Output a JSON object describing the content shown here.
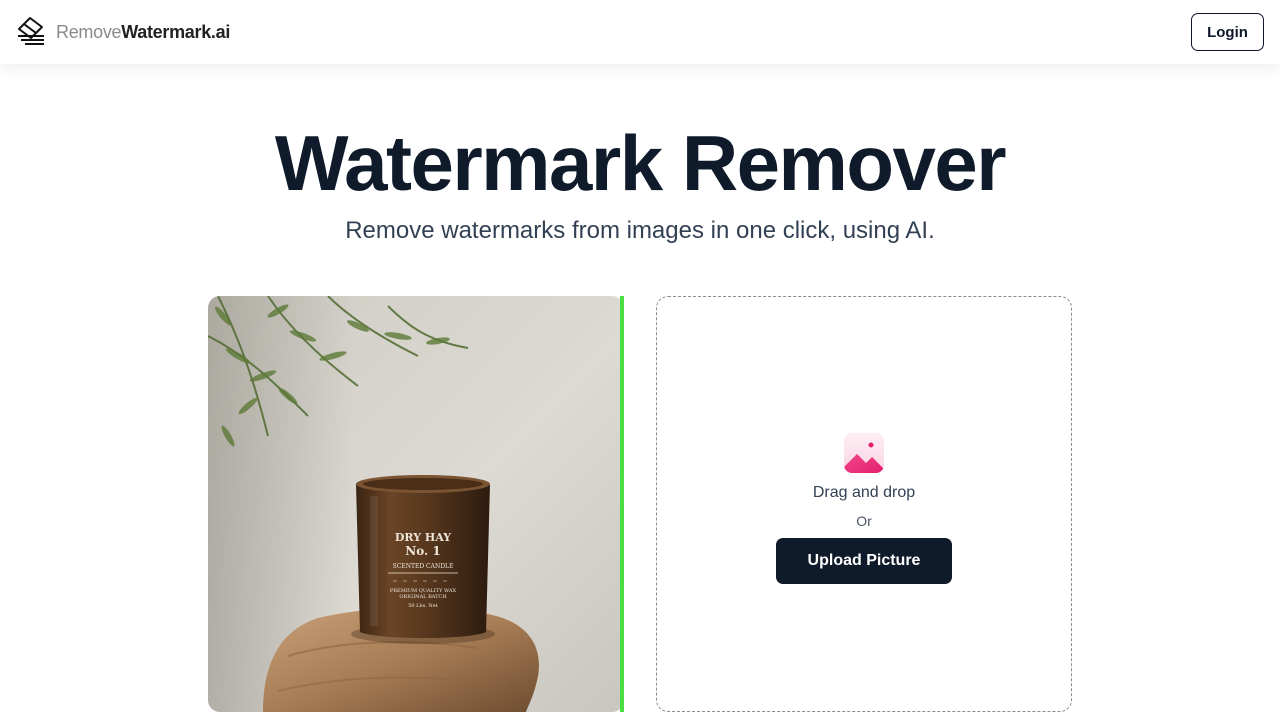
{
  "header": {
    "brand_light": "Remove",
    "brand_bold": "Watermark.ai",
    "login_label": "Login"
  },
  "hero": {
    "title": "Watermark Remover",
    "subtitle": "Remove watermarks from images in one click, using AI."
  },
  "sample_image": {
    "label_line1": "DRY HAY",
    "label_line2": "No. 1",
    "label_line3": "SCENTED CANDLE",
    "label_line4": "PREMIUM QUALITY WAX",
    "label_line5": "ORIGINAL BATCH",
    "label_line6": "50 Lbs. Net"
  },
  "dropzone": {
    "drag_text": "Drag and drop",
    "or_text": "Or",
    "upload_label": "Upload Picture"
  },
  "colors": {
    "primary": "#0f1a2a",
    "divider": "#4ade40",
    "upload_icon_bg": "#fde4ee",
    "upload_icon_accent": "#ec2f7c"
  }
}
